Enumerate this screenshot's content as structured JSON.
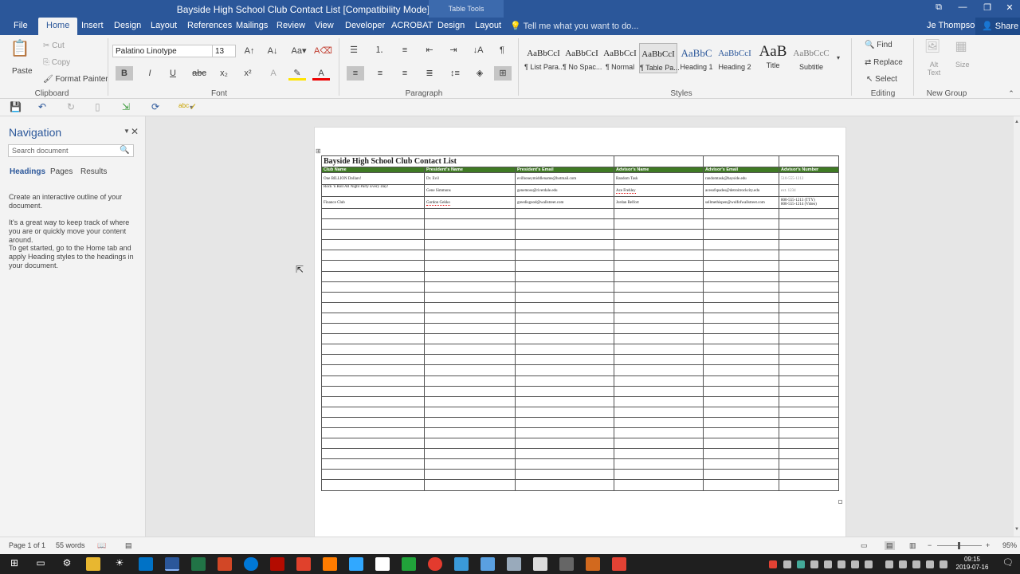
{
  "window": {
    "title": "Bayside High School Club Contact List [Compatibility Mode] - Word",
    "context_tab_group": "Table Tools",
    "controls": {
      "restore_ribbon": "⧉",
      "minimize": "—",
      "maximize": "❐",
      "close": "✕"
    }
  },
  "tabs": [
    "File",
    "Home",
    "Insert",
    "Design",
    "Layout",
    "References",
    "Mailings",
    "Review",
    "View",
    "Developer",
    "ACROBAT",
    "Design",
    "Layout"
  ],
  "tell_me": "Tell me what you want to do...",
  "user": "Je Thompson",
  "share": "Share",
  "ribbon": {
    "clipboard": {
      "label": "Clipboard",
      "paste": "Paste",
      "cut": "Cut",
      "copy": "Copy",
      "format_painter": "Format Painter"
    },
    "font": {
      "label": "Font",
      "name": "Palatino Linotype",
      "size": "13"
    },
    "paragraph": {
      "label": "Paragraph"
    },
    "styles": {
      "label": "Styles",
      "items": [
        {
          "sample": "AaBbCcI",
          "name": "¶ List Para..."
        },
        {
          "sample": "AaBbCcI",
          "name": "¶ No Spac..."
        },
        {
          "sample": "AaBbCcI",
          "name": "¶ Normal"
        },
        {
          "sample": "AaBbCcI",
          "name": "¶ Table Pa..."
        },
        {
          "sample": "AaBbC",
          "name": "Heading 1"
        },
        {
          "sample": "AaBbCcI",
          "name": "Heading 2"
        },
        {
          "sample": "AaB",
          "name": "Title"
        },
        {
          "sample": "AaBbCcC",
          "name": "Subtitle"
        }
      ]
    },
    "editing": {
      "label": "Editing",
      "find": "Find",
      "replace": "Replace",
      "select": "Select"
    },
    "new_group": {
      "label": "New Group",
      "alt_text": "Alt Text",
      "size": "Size"
    }
  },
  "nav": {
    "title": "Navigation",
    "search_placeholder": "Search document",
    "tabs": [
      "Headings",
      "Pages",
      "Results"
    ],
    "p1": "Create an interactive outline of your document.",
    "p2": "It's a great way to keep track of where you are or quickly move your content around.",
    "p3": "To get started, go to the Home tab and apply Heading styles to the headings in your document."
  },
  "document": {
    "title": "Bayside High School Club Contact List",
    "headers": [
      "Club Name",
      "President's Name",
      "President's Email",
      "Advisor's Name",
      "Advisor's Email",
      "Advisor's Number"
    ],
    "rows": [
      [
        "One BILLION Dollars!",
        "Dr. Evil",
        "evilhoneymiddlename@hotmail.com",
        "Random Task",
        "randomtask@bayside.edu",
        "510-555-1212"
      ],
      [
        "Rock 'n Roll All Night Party Every Day!",
        "Gene Simmons",
        "genemoss@riverdale.edu",
        "Ace Frehley",
        "acesofspades@detroitrockcity.edu",
        "ext. 1234"
      ],
      [
        "Finance Club",
        "Gordon Gekko",
        "greedisgood@wallstreet.com",
        "Jordan Belfort",
        "sellmethispen@wolfofwallstreet.com",
        "800-555-1213 (TTY)\n800-555-1214 (Video)"
      ]
    ],
    "empty_rows": 27
  },
  "status": {
    "page": "Page 1 of 1",
    "words": "55 words",
    "zoom": "95%"
  },
  "taskbar": {
    "time": "09:15",
    "date": "2019-07-16"
  }
}
